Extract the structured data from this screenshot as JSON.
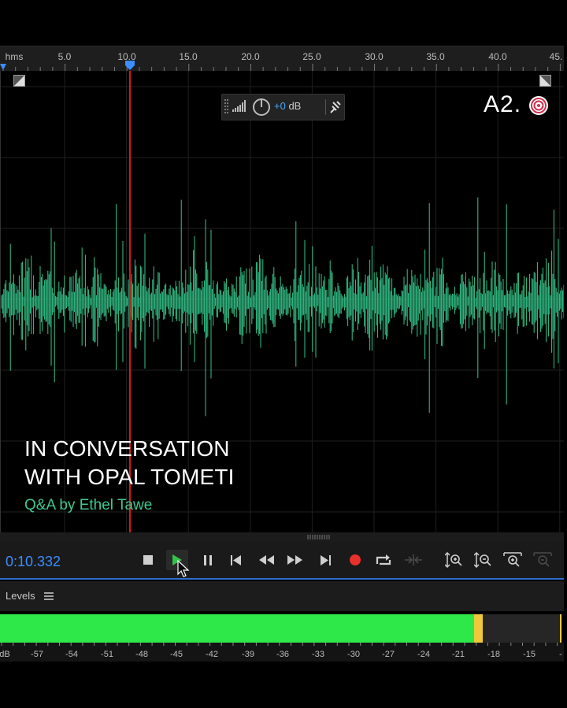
{
  "ruler": {
    "unit_label": "hms",
    "ticks": [
      "5.0",
      "10.0",
      "15.0",
      "20.0",
      "25.0",
      "30.0",
      "35.0",
      "40.0",
      "45."
    ]
  },
  "hud": {
    "gain_value": "+0",
    "gain_unit": "dB"
  },
  "watermark": {
    "logo_text": "A2."
  },
  "overlay": {
    "title_line1": "IN CONVERSATION",
    "title_line2": "WITH OPAL TOMETI",
    "subtitle": "Q&A by Ethel Tawe"
  },
  "transport": {
    "current_time": "0:10.332",
    "buttons": [
      "stop-icon",
      "play-icon",
      "pause-icon",
      "skip-to-start-icon",
      "rewind-icon",
      "fast-forward-icon",
      "skip-to-end-icon",
      "record-icon",
      "loop-icon",
      "skip-selection-icon",
      "zoom-in-amplitude-icon",
      "zoom-out-amplitude-icon",
      "zoom-in-time-icon",
      "zoom-out-time-icon"
    ]
  },
  "levels": {
    "title": "Levels",
    "scale": [
      "dB",
      "-57",
      "-54",
      "-51",
      "-48",
      "-45",
      "-42",
      "-39",
      "-36",
      "-33",
      "-30",
      "-27",
      "-24",
      "-21",
      "-18",
      "-15",
      "-"
    ],
    "level_db": -18
  },
  "colors": {
    "waveform": "#34c58a",
    "playhead": "#d01c1c",
    "accent": "#3d8dff",
    "meter_green": "#2ee84a",
    "meter_yellow": "#f0c93a"
  }
}
